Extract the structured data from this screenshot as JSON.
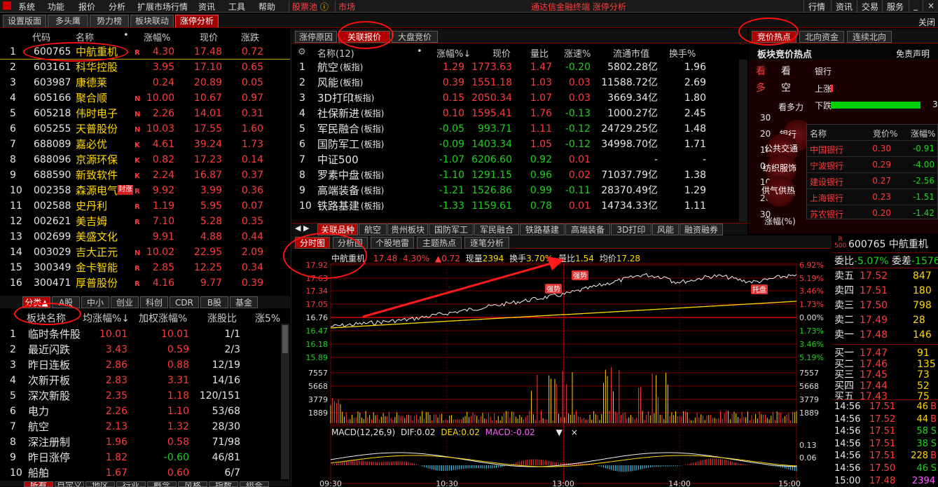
{
  "menu": {
    "items": [
      "系统",
      "功能",
      "报价",
      "分析",
      "扩展市场行情",
      "资讯",
      "工具",
      "帮助"
    ],
    "stock_pool": "股票池",
    "market": "市场",
    "center_title": "通达信金融终端  涨停分析",
    "right_buttons": [
      "行情",
      "资讯",
      "交易",
      "服务"
    ]
  },
  "tabs": {
    "items": [
      "设置版面",
      "多头鹰",
      "势力榜",
      "板块联动",
      "涨停分析"
    ],
    "close": "关闭"
  },
  "stock_list": {
    "headers": [
      "代码",
      "名称",
      "•",
      "涨幅%",
      "现价",
      "涨跌"
    ],
    "rows": [
      {
        "n": "1",
        "code": "600765",
        "name": "中航重机",
        "flag": "R",
        "pct": "4.30",
        "price": "17.48",
        "chg": "0.72"
      },
      {
        "n": "2",
        "code": "603161",
        "name": "科华控股",
        "flag": "",
        "pct": "3.95",
        "price": "17.10",
        "chg": "0.65"
      },
      {
        "n": "3",
        "code": "603987",
        "name": "康德莱",
        "flag": "",
        "pct": "0.24",
        "price": "20.89",
        "chg": "0.05"
      },
      {
        "n": "4",
        "code": "605166",
        "name": "聚合顺",
        "flag": "N",
        "pct": "10.00",
        "price": "10.67",
        "chg": "0.97"
      },
      {
        "n": "5",
        "code": "605218",
        "name": "伟时电子",
        "flag": "N",
        "pct": "2.26",
        "price": "14.01",
        "chg": "0.31"
      },
      {
        "n": "6",
        "code": "605255",
        "name": "天普股份",
        "flag": "N",
        "pct": "10.03",
        "price": "17.55",
        "chg": "1.60"
      },
      {
        "n": "7",
        "code": "688089",
        "name": "嘉必优",
        "flag": "K",
        "pct": "4.61",
        "price": "39.24",
        "chg": "1.73"
      },
      {
        "n": "8",
        "code": "688096",
        "name": "京源环保",
        "flag": "K",
        "pct": "0.82",
        "price": "17.23",
        "chg": "0.14"
      },
      {
        "n": "9",
        "code": "688590",
        "name": "新致软件",
        "flag": "K",
        "pct": "2.24",
        "price": "16.87",
        "chg": "0.37"
      },
      {
        "n": "10",
        "code": "002358",
        "name": "森源电气",
        "flag": "R",
        "pct": "9.92",
        "price": "3.99",
        "chg": "0.36"
      },
      {
        "n": "11",
        "code": "002588",
        "name": "史丹利",
        "flag": "R",
        "pct": "1.19",
        "price": "5.95",
        "chg": "0.07"
      },
      {
        "n": "12",
        "code": "002621",
        "name": "美吉姆",
        "flag": "R",
        "pct": "7.10",
        "price": "5.28",
        "chg": "0.35"
      },
      {
        "n": "13",
        "code": "002699",
        "name": "美盛文化",
        "flag": "",
        "pct": "9.91",
        "price": "4.88",
        "chg": "0.44"
      },
      {
        "n": "14",
        "code": "003029",
        "name": "吉大正元",
        "flag": "N",
        "pct": "10.02",
        "price": "22.95",
        "chg": "2.09"
      },
      {
        "n": "15",
        "code": "300349",
        "name": "金卡智能",
        "flag": "R",
        "pct": "2.85",
        "price": "12.25",
        "chg": "0.34"
      },
      {
        "n": "16",
        "code": "300471",
        "name": "厚普股份",
        "flag": "R",
        "pct": "4.16",
        "price": "9.77",
        "chg": "0.39"
      }
    ],
    "seal_tag": "封涨"
  },
  "category_tabs": [
    "分类▲",
    "A股",
    "中小",
    "创业",
    "科创",
    "CDR",
    "B股",
    "基金"
  ],
  "sector_list": {
    "headers": [
      "板块名称",
      "均涨幅%↓",
      "加权涨幅%",
      "涨股比",
      "涨5%"
    ],
    "rows": [
      {
        "n": "1",
        "name": "临时条件股",
        "avg": "10.01",
        "wavg": "10.01",
        "ratio": "1/1"
      },
      {
        "n": "2",
        "name": "最近闪跌",
        "avg": "3.43",
        "wavg": "0.59",
        "ratio": "2/3"
      },
      {
        "n": "3",
        "name": "昨日连板",
        "avg": "2.86",
        "wavg": "0.88",
        "ratio": "12/19"
      },
      {
        "n": "4",
        "name": "次新开板",
        "avg": "2.83",
        "wavg": "3.31",
        "ratio": "14/16"
      },
      {
        "n": "5",
        "name": "深次新股",
        "avg": "2.35",
        "wavg": "1.18",
        "ratio": "120/151"
      },
      {
        "n": "6",
        "name": "电力",
        "avg": "2.26",
        "wavg": "1.10",
        "ratio": "53/68"
      },
      {
        "n": "7",
        "name": "航空",
        "avg": "2.13",
        "wavg": "1.32",
        "ratio": "28/30"
      },
      {
        "n": "8",
        "name": "深注册制",
        "avg": "1.96",
        "wavg": "0.58",
        "ratio": "71/98"
      },
      {
        "n": "9",
        "name": "昨日涨停",
        "avg": "1.82",
        "wavg": "-0.60",
        "ratio": "46/81"
      },
      {
        "n": "10",
        "name": "船舶",
        "avg": "1.67",
        "wavg": "0.60",
        "ratio": "6/7"
      }
    ]
  },
  "bottom_tabs": [
    "所有",
    "自定义",
    "地区",
    "行业",
    "概念",
    "风格",
    "指数",
    "组合"
  ],
  "related": {
    "tabs": [
      "涨停原因",
      "关联报价",
      "大盘竞价"
    ],
    "headers": [
      "名称(12)",
      "•",
      "涨幅%↓",
      "现价",
      "量比",
      "涨速%",
      "流通市值",
      "换手%"
    ],
    "rows": [
      {
        "n": "1",
        "name": "航空",
        "tag": "(板指)",
        "pct": "1.29",
        "price": "1773.63",
        "vr": "1.47",
        "spd": "-0.20",
        "cap": "5802.28亿",
        "turn": "1.96"
      },
      {
        "n": "2",
        "name": "风能",
        "tag": "(板指)",
        "pct": "0.39",
        "price": "1551.18",
        "vr": "1.03",
        "spd": "0.03",
        "cap": "11588.72亿",
        "turn": "2.69"
      },
      {
        "n": "3",
        "name": "3D打印",
        "tag": "(板指)",
        "pct": "0.15",
        "price": "2050.34",
        "vr": "1.07",
        "spd": "0.03",
        "cap": "3669.34亿",
        "turn": "1.80"
      },
      {
        "n": "4",
        "name": "社保新进",
        "tag": "(板指)",
        "pct": "0.10",
        "price": "1595.41",
        "vr": "1.76",
        "spd": "-0.13",
        "cap": "1000.27亿",
        "turn": "2.45"
      },
      {
        "n": "5",
        "name": "军民融合",
        "tag": "(板指)",
        "pct": "-0.05",
        "price": "993.71",
        "vr": "1.11",
        "spd": "-0.12",
        "cap": "24729.25亿",
        "turn": "1.48"
      },
      {
        "n": "6",
        "name": "国防军工",
        "tag": "(板指)",
        "pct": "-0.09",
        "price": "1403.34",
        "vr": "1.05",
        "spd": "-0.12",
        "cap": "34998.70亿",
        "turn": "1.71"
      },
      {
        "n": "7",
        "name": "中证500",
        "tag": "",
        "pct": "-1.07",
        "price": "6206.60",
        "vr": "0.92",
        "spd": "0.01",
        "cap": "-",
        "turn": "-"
      },
      {
        "n": "8",
        "name": "罗素中盘",
        "tag": "(板指)",
        "pct": "-1.10",
        "price": "1291.15",
        "vr": "0.96",
        "spd": "0.02",
        "cap": "71037.79亿",
        "turn": "1.38"
      },
      {
        "n": "9",
        "name": "高端装备",
        "tag": "(板指)",
        "pct": "-1.21",
        "price": "1526.86",
        "vr": "0.99",
        "spd": "-0.11",
        "cap": "28370.49亿",
        "turn": "1.29"
      },
      {
        "n": "10",
        "name": "铁路基建",
        "tag": "(板指)",
        "pct": "-1.33",
        "price": "1159.61",
        "vr": "0.78",
        "spd": "0.01",
        "cap": "14734.33亿",
        "turn": "1.11"
      }
    ],
    "sector_tabs": [
      "关联品种",
      "航空",
      "贵州板块",
      "国防军工",
      "军民融合",
      "铁路基建",
      "高端装备",
      "3D打印",
      "风能",
      "融资融券"
    ]
  },
  "hotspot": {
    "tabs": [
      "竞价热点",
      "北向资金",
      "连续北向"
    ],
    "title": "板块竞价热点",
    "disclaimer": "免责声明",
    "labels": {
      "kan": "看",
      "kong": "空",
      "duo": "多",
      "kan2": "看",
      "bank": "银行",
      "up": "上涨",
      "down": "下跌",
      "kdl": "看多力",
      "pct_label": "涨幅(%)"
    },
    "bubbles": [
      "银行",
      "公共交通",
      "纺织服饰",
      "供气供热"
    ],
    "axis": [
      "30",
      "20",
      "10",
      "0",
      "10",
      "20",
      "30"
    ],
    "table_headers": [
      "名称",
      "竞价%",
      "涨幅%"
    ],
    "table_rows": [
      {
        "name": "中国银行",
        "bid": "0.30",
        "pct": "-0.91"
      },
      {
        "name": "宁波银行",
        "bid": "0.29",
        "pct": "-4.00"
      },
      {
        "name": "建设银行",
        "bid": "0.27",
        "pct": "-2.56"
      },
      {
        "name": "上海银行",
        "bid": "0.23",
        "pct": "-1.51"
      },
      {
        "name": "苏农银行",
        "bid": "0.20",
        "pct": "-1.42"
      }
    ]
  },
  "chart": {
    "tabs": [
      "分时图",
      "分析图",
      "个股地雷",
      "主题热点",
      "逐笔分析"
    ],
    "info": {
      "name": "中航重机",
      "price": "17.48",
      "pct": "4.30%",
      "chg": "▲0.72",
      "vol_label": "现量",
      "vol": "2394",
      "turn_label": "换手",
      "turn": "3.70%",
      "vr_label": "量比",
      "vr": "1.54",
      "avg_label": "均价",
      "avg": "17.28"
    },
    "price_ticks": [
      "17.92",
      "17.63",
      "17.34",
      "17.05",
      "16.76",
      "16.47",
      "16.18",
      "15.89"
    ],
    "pct_ticks": [
      "6.92%",
      "5.19%",
      "3.46%",
      "1.73%",
      "0.00%",
      "1.73%",
      "3.46%",
      "5.19%"
    ],
    "vol_ticks": [
      "7557",
      "5668",
      "3779",
      "1889"
    ],
    "macd_label": "MACD(12,26,9)",
    "dif_label": "DIF:",
    "dif": "0.02",
    "dea_label": "DEA:",
    "dea": "0.02",
    "macd_val_label": "MACD:",
    "macd": "-0.02",
    "macd_ticks": [
      "0.13",
      "0.06"
    ],
    "time_ticks": [
      "09:30",
      "10:30",
      "13:00",
      "14:00",
      "15:00"
    ],
    "marks": [
      "强势",
      "强势",
      "托盘"
    ]
  },
  "quote": {
    "code": "600765",
    "name": "中航重机",
    "r_label": "R",
    "sub": "500",
    "weibi_label": "委比",
    "weibi": "-5.07%",
    "weicha_label": "委差",
    "weicha": "-1576",
    "sells": [
      {
        "l": "卖五",
        "p": "17.52",
        "v": "847"
      },
      {
        "l": "卖四",
        "p": "17.51",
        "v": "180"
      },
      {
        "l": "卖三",
        "p": "17.50",
        "v": "798"
      },
      {
        "l": "卖二",
        "p": "17.49",
        "v": "28"
      },
      {
        "l": "卖一",
        "p": "17.48",
        "v": "146"
      }
    ],
    "buys": [
      {
        "l": "买一",
        "p": "17.47",
        "v": "91"
      },
      {
        "l": "买二",
        "p": "17.46",
        "v": "135"
      },
      {
        "l": "买三",
        "p": "17.45",
        "v": "73"
      },
      {
        "l": "买四",
        "p": "17.44",
        "v": "52"
      },
      {
        "l": "买五",
        "p": "17.43",
        "v": "75"
      }
    ],
    "ticks": [
      {
        "t": "14:56",
        "p": "17.51",
        "v": "46",
        "f": "B"
      },
      {
        "t": "14:56",
        "p": "17.52",
        "v": "44",
        "f": "B"
      },
      {
        "t": "14:56",
        "p": "17.51",
        "v": "58",
        "f": "S"
      },
      {
        "t": "14:56",
        "p": "17.51",
        "v": "38",
        "f": "S"
      },
      {
        "t": "14:56",
        "p": "17.51",
        "v": "228",
        "f": "B"
      },
      {
        "t": "14:56",
        "p": "17.50",
        "v": "46",
        "f": "S"
      },
      {
        "t": "15:00",
        "p": "17.48",
        "v": "2394",
        "f": ""
      }
    ]
  }
}
